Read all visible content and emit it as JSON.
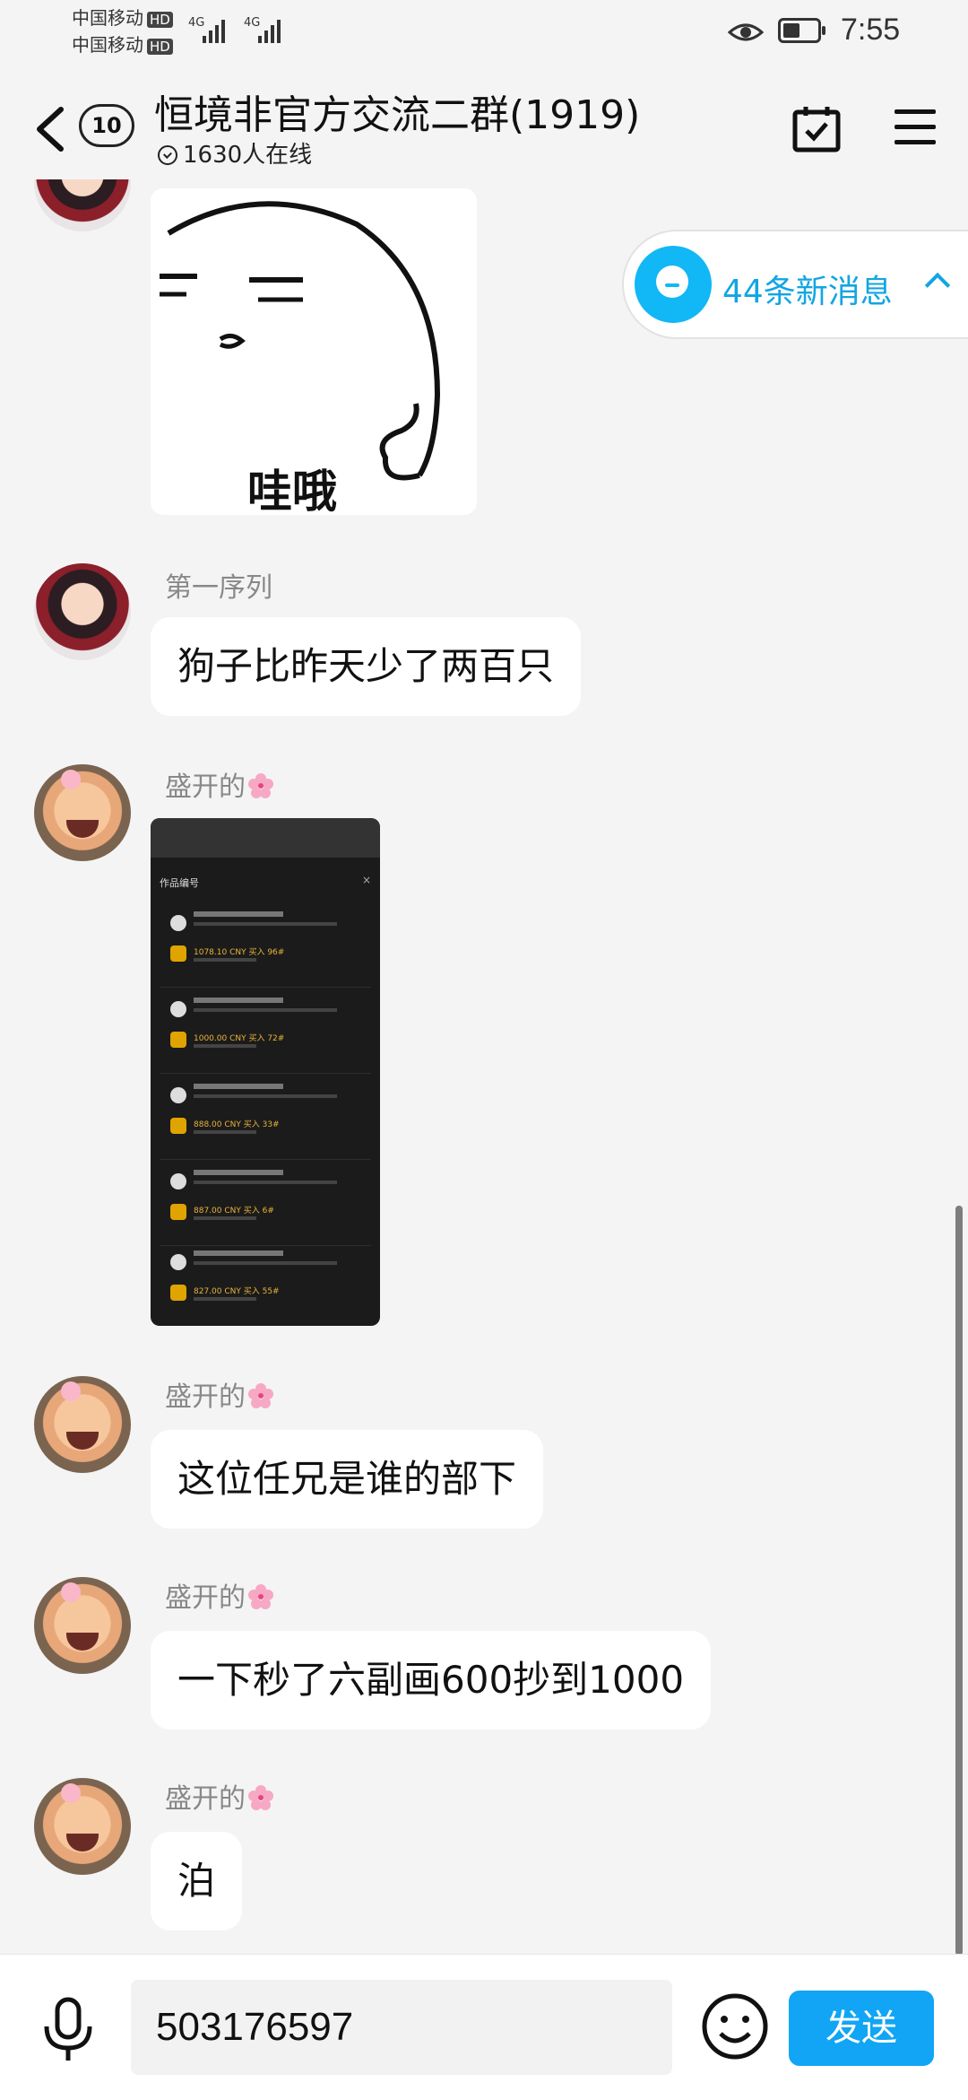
{
  "status_bar": {
    "carrier1": "中国移动",
    "carrier2": "中国移动",
    "hd": "HD",
    "network": "4G",
    "time": "7:55"
  },
  "header": {
    "back_count": "10",
    "title": "恒境非官方交流二群(1919)",
    "online": "1630人在线"
  },
  "new_messages": {
    "label": "44条新消息"
  },
  "messages": [
    {
      "type": "sticker",
      "caption": "哇哦"
    },
    {
      "sender": "第一序列",
      "text": "狗子比昨天少了两百只"
    },
    {
      "sender": "盛开的",
      "type": "image"
    },
    {
      "sender": "盛开的",
      "text": "这位任兄是谁的部下"
    },
    {
      "sender": "盛开的",
      "text": "一下秒了六副画600抄到1000"
    },
    {
      "sender": "盛开的",
      "text": "泊"
    }
  ],
  "screenshot_image": {
    "heading": "作品编号",
    "close": "×",
    "items": [
      {
        "price": "1078.10 CNY 买入 96#"
      },
      {
        "price": "1000.00 CNY 买入 72#"
      },
      {
        "price": "888.00 CNY 买入 33#"
      },
      {
        "price": "887.00 CNY 买入 6#"
      },
      {
        "price": "827.00 CNY 买入 55#"
      }
    ]
  },
  "input": {
    "value": "503176597",
    "send_label": "发送"
  },
  "colors": {
    "accent": "#12a5f5",
    "background": "#f4f4f4",
    "bubble": "#ffffff"
  }
}
